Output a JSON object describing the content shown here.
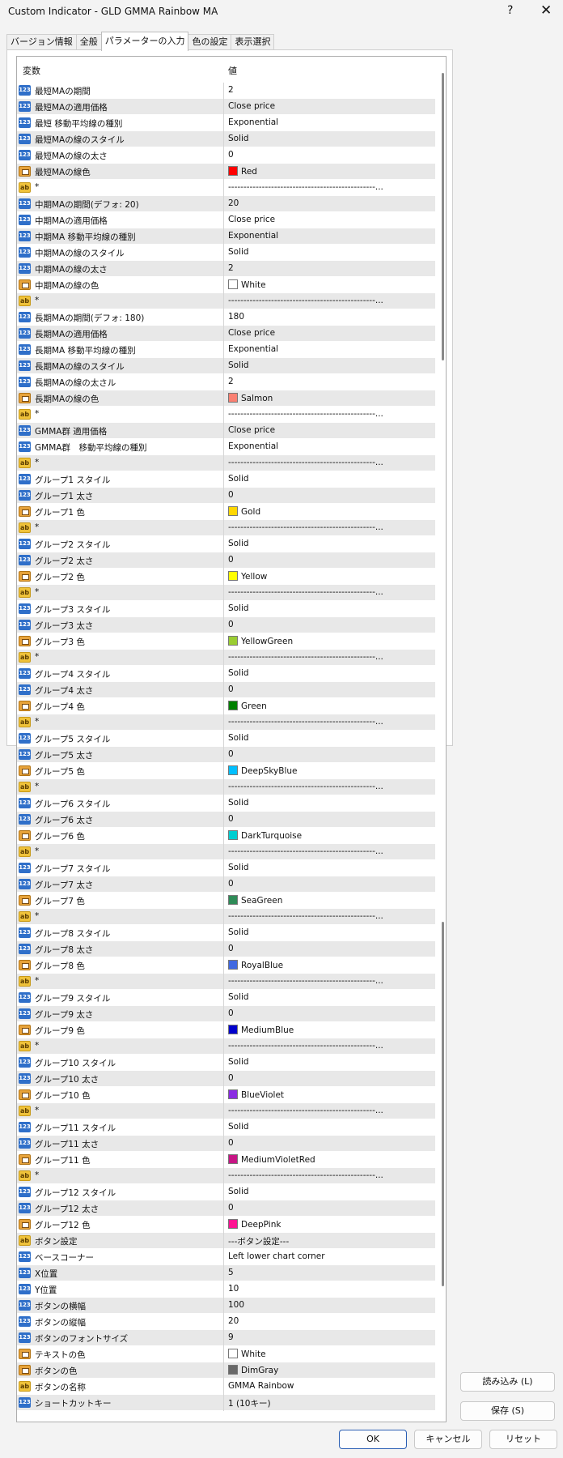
{
  "window": {
    "title": "Custom Indicator - GLD GMMA Rainbow MA",
    "help": "?",
    "close": "✕"
  },
  "tabs": [
    "バージョン情報",
    "全般",
    "パラメーターの入力",
    "色の設定",
    "表示選択"
  ],
  "grid": {
    "col_name": "変数",
    "col_value": "値"
  },
  "rows": [
    {
      "t": "num",
      "n": "最短MAの期間",
      "v": "2"
    },
    {
      "t": "num",
      "n": "最短MAの適用価格",
      "v": "Close price"
    },
    {
      "t": "num",
      "n": "最短 移動平均線の種別",
      "v": "Exponential"
    },
    {
      "t": "num",
      "n": "最短MAの線のスタイル",
      "v": "Solid"
    },
    {
      "t": "num",
      "n": "最短MAの線の太さ",
      "v": "0"
    },
    {
      "t": "clr",
      "n": "最短MAの線色",
      "v": "Red",
      "c": "#ff0000"
    },
    {
      "t": "str",
      "n": "*",
      "v": "------------------------------------------------..."
    },
    {
      "t": "num",
      "n": "中期MAの期間(デフォ: 20)",
      "v": "20"
    },
    {
      "t": "num",
      "n": "中期MAの適用価格",
      "v": "Close price"
    },
    {
      "t": "num",
      "n": "中期MA 移動平均線の種別",
      "v": "Exponential"
    },
    {
      "t": "num",
      "n": "中期MAの線のスタイル",
      "v": "Solid"
    },
    {
      "t": "num",
      "n": "中期MAの線の太さ",
      "v": "2"
    },
    {
      "t": "clr",
      "n": "中期MAの線の色",
      "v": "White",
      "c": "#ffffff"
    },
    {
      "t": "str",
      "n": "*",
      "v": "------------------------------------------------..."
    },
    {
      "t": "num",
      "n": "長期MAの期間(デフォ: 180)",
      "v": "180"
    },
    {
      "t": "num",
      "n": "長期MAの適用価格",
      "v": "Close price"
    },
    {
      "t": "num",
      "n": "長期MA 移動平均線の種別",
      "v": "Exponential"
    },
    {
      "t": "num",
      "n": "長期MAの線のスタイル",
      "v": "Solid"
    },
    {
      "t": "num",
      "n": "長期MAの線の太さル",
      "v": "2"
    },
    {
      "t": "clr",
      "n": "長期MAの線の色",
      "v": "Salmon",
      "c": "#fa8072"
    },
    {
      "t": "str",
      "n": "*",
      "v": "------------------------------------------------..."
    },
    {
      "t": "num",
      "n": "GMMA群 適用価格",
      "v": "Close price"
    },
    {
      "t": "num",
      "n": "GMMA群　移動平均線の種別",
      "v": "Exponential"
    },
    {
      "t": "str",
      "n": "*",
      "v": "------------------------------------------------..."
    },
    {
      "t": "num",
      "n": "グループ1 スタイル",
      "v": "Solid"
    },
    {
      "t": "num",
      "n": "グループ1 太さ",
      "v": "0"
    },
    {
      "t": "clr",
      "n": "グループ1 色",
      "v": "Gold",
      "c": "#ffd700"
    },
    {
      "t": "str",
      "n": "*",
      "v": "------------------------------------------------..."
    },
    {
      "t": "num",
      "n": "グループ2 スタイル",
      "v": "Solid"
    },
    {
      "t": "num",
      "n": "グループ2 太さ",
      "v": "0"
    },
    {
      "t": "clr",
      "n": "グループ2 色",
      "v": "Yellow",
      "c": "#ffff00"
    },
    {
      "t": "str",
      "n": "*",
      "v": "------------------------------------------------..."
    },
    {
      "t": "num",
      "n": "グループ3 スタイル",
      "v": "Solid"
    },
    {
      "t": "num",
      "n": "グループ3 太さ",
      "v": "0"
    },
    {
      "t": "clr",
      "n": "グループ3 色",
      "v": "YellowGreen",
      "c": "#9acd32"
    },
    {
      "t": "str",
      "n": "*",
      "v": "------------------------------------------------..."
    },
    {
      "t": "num",
      "n": "グループ4 スタイル",
      "v": "Solid"
    },
    {
      "t": "num",
      "n": "グループ4 太さ",
      "v": "0"
    },
    {
      "t": "clr",
      "n": "グループ4 色",
      "v": "Green",
      "c": "#008000"
    },
    {
      "t": "str",
      "n": "*",
      "v": "------------------------------------------------..."
    },
    {
      "t": "num",
      "n": "グループ5 スタイル",
      "v": "Solid"
    },
    {
      "t": "num",
      "n": "グループ5 太さ",
      "v": "0"
    },
    {
      "t": "clr",
      "n": "グループ5 色",
      "v": "DeepSkyBlue",
      "c": "#00bfff"
    },
    {
      "t": "str",
      "n": "*",
      "v": "------------------------------------------------..."
    },
    {
      "t": "num",
      "n": "グループ6 スタイル",
      "v": "Solid"
    },
    {
      "t": "num",
      "n": "グループ6 太さ",
      "v": "0"
    },
    {
      "t": "clr",
      "n": "グループ6 色",
      "v": "DarkTurquoise",
      "c": "#00ced1"
    },
    {
      "t": "str",
      "n": "*",
      "v": "------------------------------------------------..."
    },
    {
      "t": "num",
      "n": "グループ7 スタイル",
      "v": "Solid"
    },
    {
      "t": "num",
      "n": "グループ7 太さ",
      "v": "0"
    },
    {
      "t": "clr",
      "n": "グループ7 色",
      "v": "SeaGreen",
      "c": "#2e8b57"
    },
    {
      "t": "str",
      "n": "*",
      "v": "------------------------------------------------..."
    },
    {
      "t": "num",
      "n": "グループ8 スタイル",
      "v": "Solid"
    },
    {
      "t": "num",
      "n": "グループ8 太さ",
      "v": "0"
    },
    {
      "t": "clr",
      "n": "グループ8 色",
      "v": "RoyalBlue",
      "c": "#4169e1"
    },
    {
      "t": "str",
      "n": "*",
      "v": "------------------------------------------------..."
    },
    {
      "t": "num",
      "n": "グループ9 スタイル",
      "v": "Solid"
    },
    {
      "t": "num",
      "n": "グループ9 太さ",
      "v": "0"
    },
    {
      "t": "clr",
      "n": "グループ9 色",
      "v": "MediumBlue",
      "c": "#0000cd"
    },
    {
      "t": "str",
      "n": "*",
      "v": "------------------------------------------------..."
    },
    {
      "t": "num",
      "n": "グループ10 スタイル",
      "v": "Solid"
    },
    {
      "t": "num",
      "n": "グループ10 太さ",
      "v": "0"
    },
    {
      "t": "clr",
      "n": "グループ10 色",
      "v": "BlueViolet",
      "c": "#8a2be2"
    },
    {
      "t": "str",
      "n": "*",
      "v": "------------------------------------------------..."
    },
    {
      "t": "num",
      "n": "グループ11 スタイル",
      "v": "Solid"
    },
    {
      "t": "num",
      "n": "グループ11 太さ",
      "v": "0"
    },
    {
      "t": "clr",
      "n": "グループ11 色",
      "v": "MediumVioletRed",
      "c": "#c71585"
    },
    {
      "t": "str",
      "n": "*",
      "v": "------------------------------------------------..."
    },
    {
      "t": "num",
      "n": "グループ12 スタイル",
      "v": "Solid"
    },
    {
      "t": "num",
      "n": "グループ12 太さ",
      "v": "0"
    },
    {
      "t": "clr",
      "n": "グループ12 色",
      "v": "DeepPink",
      "c": "#ff1493"
    },
    {
      "t": "str",
      "n": "ボタン設定",
      "v": "---ボタン設定---"
    },
    {
      "t": "num",
      "n": "ベースコーナー",
      "v": "Left lower chart corner"
    },
    {
      "t": "num",
      "n": "X位置",
      "v": "5"
    },
    {
      "t": "num",
      "n": "Y位置",
      "v": "10"
    },
    {
      "t": "num",
      "n": "ボタンの横幅",
      "v": "100"
    },
    {
      "t": "num",
      "n": "ボタンの縦幅",
      "v": "20"
    },
    {
      "t": "num",
      "n": "ボタンのフォントサイズ",
      "v": "9"
    },
    {
      "t": "clr",
      "n": "テキストの色",
      "v": "White",
      "c": "#ffffff"
    },
    {
      "t": "clr",
      "n": "ボタンの色",
      "v": "DimGray",
      "c": "#696969"
    },
    {
      "t": "str",
      "n": "ボタンの名称",
      "v": "GMMA Rainbow"
    },
    {
      "t": "num",
      "n": "ショートカットキー",
      "v": "1 (10キー)"
    }
  ],
  "icons": {
    "num": "123",
    "str": "ab",
    "clr": "color-icon"
  },
  "buttons": {
    "load": "読み込み (L)",
    "save": "保存 (S)",
    "ok": "OK",
    "cancel": "キャンセル",
    "reset": "リセット"
  }
}
